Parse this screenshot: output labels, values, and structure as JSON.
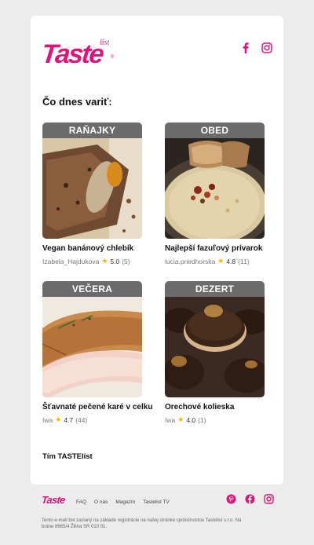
{
  "brand": {
    "name": "Taste",
    "suffix": "list",
    "reg": "®",
    "color": "#e0137c"
  },
  "header": {
    "social": [
      {
        "icon": "facebook-icon"
      },
      {
        "icon": "instagram-icon"
      }
    ]
  },
  "main": {
    "heading": "Čo dnes variť:",
    "recipes": [
      {
        "category": "RAŇAJKY",
        "title": "Vegan banánový chlebík",
        "author": "Izabela_Hajdukova",
        "rating": "5.0",
        "reviews": "(5)"
      },
      {
        "category": "OBED",
        "title": "Najlepší fazuľový prívarok",
        "author": "lucia.priedhorska",
        "rating": "4.8",
        "reviews": "(11)"
      },
      {
        "category": "VEČERA",
        "title": "Šťavnaté pečené karé v celku",
        "author": "Iwa",
        "rating": "4.7",
        "reviews": "(44)"
      },
      {
        "category": "DEZERT",
        "title": "Orechové kolieska",
        "author": "Iwa",
        "rating": "4.0",
        "reviews": "(1)"
      }
    ],
    "signoff": "Tím TASTElist"
  },
  "footer": {
    "logo": "Taste",
    "nav": [
      "FAQ",
      "O nás",
      "Magazín",
      "Tastelist TV"
    ],
    "social": [
      {
        "icon": "pinterest-icon"
      },
      {
        "icon": "facebook-icon"
      },
      {
        "icon": "instagram-icon"
      }
    ],
    "note": "Tento e-mail bol zaslaný na základe registrácie na našej stránke spoločnostou Tastelist s.r.o. Na bráne 8665/4 Žilina SR 010 01."
  }
}
